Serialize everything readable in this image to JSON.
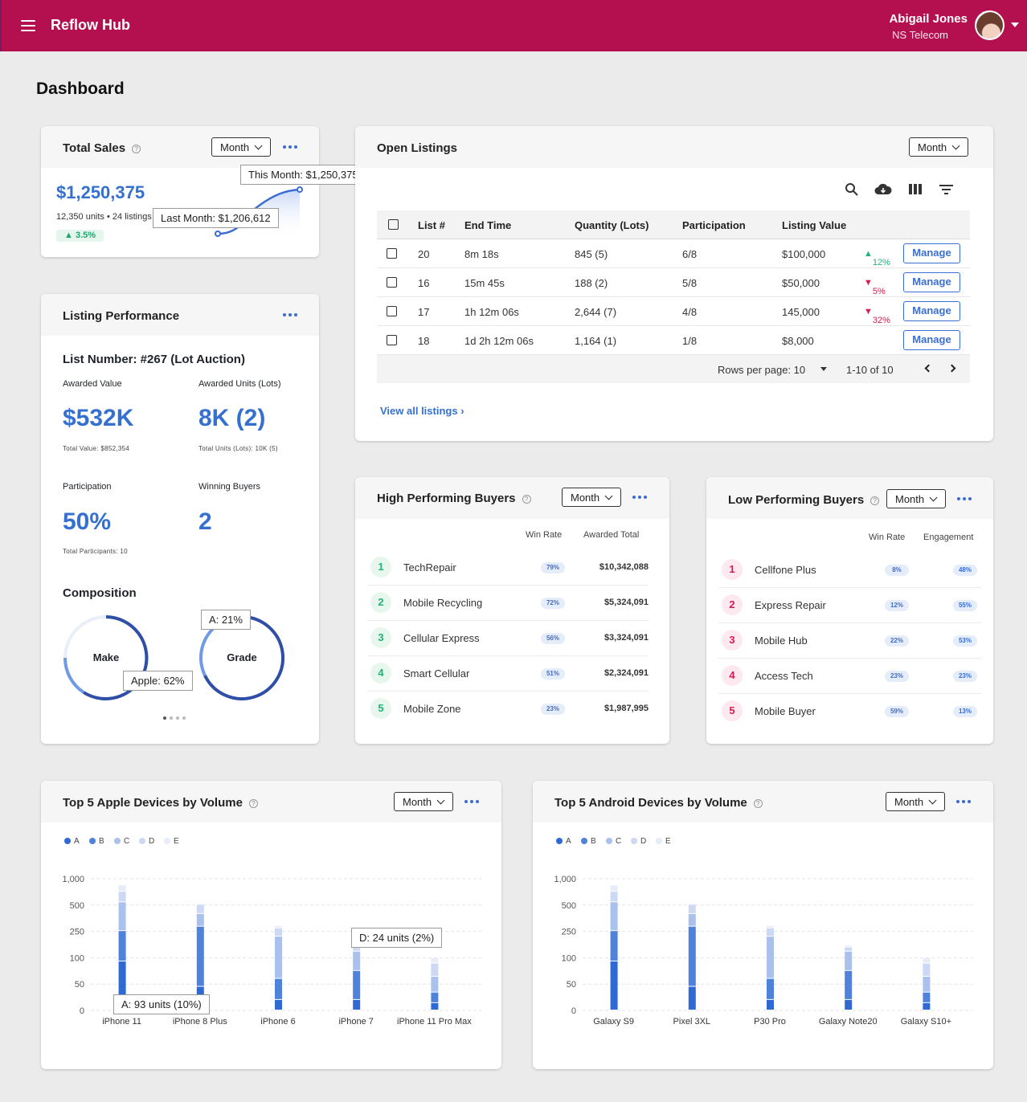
{
  "app": {
    "title": "Reflow Hub",
    "user_name": "Abigail Jones",
    "user_org": "NS Telecom"
  },
  "page": {
    "title": "Dashboard"
  },
  "period_label": "Month",
  "total_sales": {
    "title": "Total Sales",
    "value": "$1,250,375",
    "sub": "12,350 units • 24 listings",
    "change": "3.5%",
    "tip_this": "This Month: $1,250,375",
    "tip_last": "Last Month: $1,206,612"
  },
  "open_listings": {
    "title": "Open Listings",
    "columns": [
      "List #",
      "End Time",
      "Quantity (Lots)",
      "Participation",
      "Listing Value"
    ],
    "rows": [
      {
        "list": "20",
        "end": "8m 18s",
        "qty": "845 (5)",
        "part": "6/8",
        "value": "$100,000",
        "change": "12%",
        "dir": "up",
        "action": "Manage"
      },
      {
        "list": "16",
        "end": "15m 45s",
        "qty": "188 (2)",
        "part": "5/8",
        "value": "$50,000",
        "change": "5%",
        "dir": "down",
        "action": "Manage"
      },
      {
        "list": "17",
        "end": "1h 12m 06s",
        "qty": "2,644 (7)",
        "part": "4/8",
        "value": "145,000",
        "change": "32%",
        "dir": "down",
        "action": "Manage"
      },
      {
        "list": "18",
        "end": "1d 2h 12m 06s",
        "qty": "1,164 (1)",
        "part": "1/8",
        "value": "$8,000",
        "change": "",
        "dir": "",
        "action": "Manage"
      }
    ],
    "rows_per_page": "Rows per page: 10",
    "range": "1-10 of 10",
    "view_all": "View all listings"
  },
  "listing_performance": {
    "title": "Listing Performance",
    "list_number": "List Number: #267 (Lot Auction)",
    "awarded_value_label": "Awarded Value",
    "awarded_value": "$532K",
    "total_value": "Total Value: $852,354",
    "awarded_units_label": "Awarded Units (Lots)",
    "awarded_units": "8K (2)",
    "total_units": "Total Units (Lots): 10K (5)",
    "participation_label": "Participation",
    "participation": "50%",
    "total_participants": "Total Participants: 10",
    "winning_buyers_label": "Winning Buyers",
    "winning_buyers": "2",
    "composition_title": "Composition",
    "donut1_label": "Make",
    "donut1_tip": "Apple: 62%",
    "donut2_label": "Grade",
    "donut2_tip": "A: 21%"
  },
  "high_buyers": {
    "title": "High Performing Buyers",
    "col1": "Win Rate",
    "col2": "Awarded Total",
    "rows": [
      {
        "rank": "1",
        "name": "TechRepair",
        "rate": "79%",
        "total": "$10,342,088"
      },
      {
        "rank": "2",
        "name": "Mobile Recycling",
        "rate": "72%",
        "total": "$5,324,091"
      },
      {
        "rank": "3",
        "name": "Cellular Express",
        "rate": "56%",
        "total": "$3,324,091"
      },
      {
        "rank": "4",
        "name": "Smart Cellular",
        "rate": "51%",
        "total": "$2,324,091"
      },
      {
        "rank": "5",
        "name": "Mobile Zone",
        "rate": "23%",
        "total": "$1,987,995"
      }
    ]
  },
  "low_buyers": {
    "title": "Low Performing Buyers",
    "col1": "Win Rate",
    "col2": "Engagement",
    "rows": [
      {
        "rank": "1",
        "name": "Cellfone Plus",
        "rate": "8%",
        "eng": "48%"
      },
      {
        "rank": "2",
        "name": "Express Repair",
        "rate": "12%",
        "eng": "55%"
      },
      {
        "rank": "3",
        "name": "Mobile Hub",
        "rate": "22%",
        "eng": "53%"
      },
      {
        "rank": "4",
        "name": "Access Tech",
        "rate": "23%",
        "eng": "23%"
      },
      {
        "rank": "5",
        "name": "Mobile Buyer",
        "rate": "59%",
        "eng": "13%"
      }
    ]
  },
  "chart_data": [
    {
      "type": "bar",
      "title": "Top 5 Apple Devices by Volume",
      "categories": [
        "iPhone 11",
        "iPhone 8 Plus",
        "iPhone 6",
        "iPhone 7",
        "iPhone 11 Pro Max"
      ],
      "yticks": [
        "0",
        "50",
        "100",
        "250",
        "500",
        "1,000"
      ],
      "series": [
        {
          "name": "A",
          "values": [
            93,
            45,
            20,
            20,
            14
          ]
        },
        {
          "name": "B",
          "values": [
            160,
            250,
            40,
            55,
            20
          ]
        },
        {
          "name": "C",
          "values": [
            300,
            120,
            160,
            60,
            30
          ]
        },
        {
          "name": "D",
          "values": [
            200,
            90,
            60,
            24,
            25
          ]
        },
        {
          "name": "E",
          "values": [
            120,
            20,
            20,
            10,
            10
          ]
        }
      ],
      "tips": [
        "A: 93 units (10%)",
        "D: 24 units (2%)"
      ],
      "colors": [
        "#2f6ad4",
        "#4f82da",
        "#a9c1ec",
        "#cdd9f4",
        "#e6ecf8"
      ]
    },
    {
      "type": "bar",
      "title": "Top 5 Android Devices by Volume",
      "categories": [
        "Galaxy S9",
        "Pixel 3XL",
        "P30 Pro",
        "Galaxy Note20",
        "Galaxy S10+"
      ],
      "yticks": [
        "0",
        "50",
        "100",
        "250",
        "500",
        "1,000"
      ],
      "series": [
        {
          "name": "A",
          "values": [
            93,
            45,
            20,
            20,
            14
          ]
        },
        {
          "name": "B",
          "values": [
            160,
            250,
            40,
            55,
            20
          ]
        },
        {
          "name": "C",
          "values": [
            300,
            120,
            160,
            60,
            30
          ]
        },
        {
          "name": "D",
          "values": [
            200,
            90,
            60,
            24,
            25
          ]
        },
        {
          "name": "E",
          "values": [
            120,
            20,
            20,
            10,
            10
          ]
        }
      ],
      "colors": [
        "#2f6ad4",
        "#4f82da",
        "#a9c1ec",
        "#cdd9f4",
        "#e6ecf8"
      ]
    }
  ]
}
